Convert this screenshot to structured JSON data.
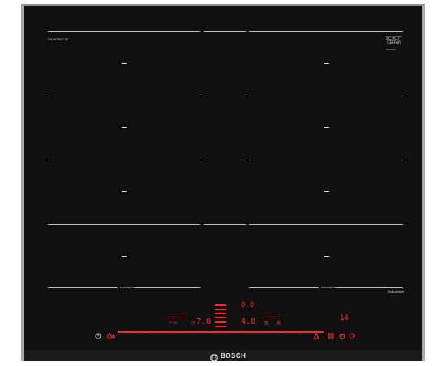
{
  "cooktop": {
    "model_code": "PXX975DC1E",
    "glass_brand": "SCHOTT CERAN",
    "glass_brand_sub": "Premium",
    "induction_label": "Induction",
    "brand": "BOSCH"
  },
  "zones": {
    "marker": "-",
    "flex_left_label": "DirectSelect",
    "flex_right_label": "DirectSelect"
  },
  "controls": {
    "power_icon": "power-icon",
    "timer_value_main_1": "7.0",
    "timer_value_main_2": "4.0",
    "upper_display_value": "0.0",
    "clock_display_value": "14",
    "scale": [
      "0",
      "1",
      "2",
      "3",
      "4",
      "5",
      "6",
      "7",
      "8",
      "9",
      "10",
      "11",
      "12",
      "13",
      "14",
      "15",
      "16",
      "17"
    ]
  }
}
